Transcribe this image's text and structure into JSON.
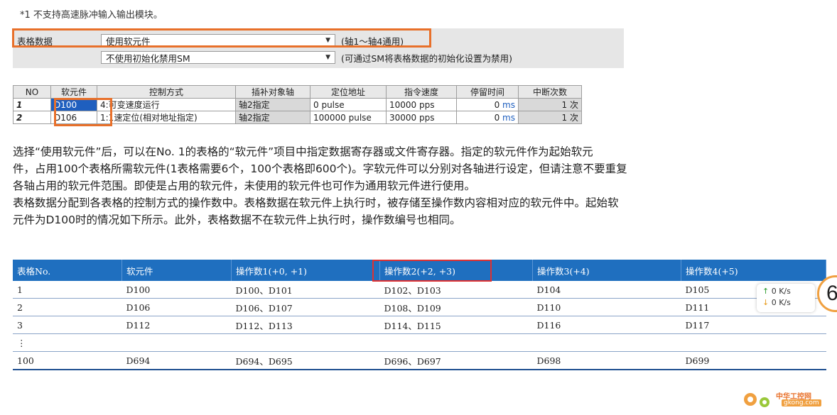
{
  "note": "*1  不支持高速脉冲输入输出模块。",
  "settings": {
    "label": "表格数据",
    "dropdown1": "使用软元件",
    "note1": "(轴1～轴4通用)",
    "dropdown2": "不使用初始化禁用SM",
    "note2": "(可通过SM将表格数据的初始化设置为禁用)"
  },
  "grid": {
    "headers": [
      "NO",
      "软元件",
      "控制方式",
      "插补对象轴",
      "定位地址",
      "指令速度",
      "停留时间",
      "中断次数"
    ],
    "rows": [
      {
        "no": "1",
        "device": "D100",
        "method": "4:可变速度运行",
        "axis": "轴2指定",
        "addr": "0 pulse",
        "speed": "10000 pps",
        "dwell": "0",
        "dwell_unit": "ms",
        "count": "1 次"
      },
      {
        "no": "2",
        "device": "D106",
        "method": "1:1速定位(相对地址指定)",
        "axis": "轴2指定",
        "addr": "100000 pulse",
        "speed": "30000 pps",
        "dwell": "0",
        "dwell_unit": "ms",
        "count": "1 次"
      }
    ]
  },
  "paragraph": {
    "line1": "选择“使用软元件”后，可以在No. 1的表格的“软元件”项目中指定数据寄存器或文件寄存器。指定的软元件作为起始软元",
    "line2": "件，占用100个表格所需软元件(1表格需要6个，100个表格即600个)。字软元件可以分别对各轴进行设定，但请注意不要重复",
    "line3": "各轴占用的软元件范围。即使是占用的软元件，未使用的软元件也可作为通用软元件进行使用。",
    "line4": "表格数据分配到各表格的控制方式的操作数中。表格数据在软元件上执行时，被存储至操作数内容相对应的软元件中。起始软",
    "line5": "元件为D100时的情况如下所示。此外，表格数据不在软元件上执行时，操作数编号也相同。"
  },
  "table": {
    "headers": [
      "表格No.",
      "软元件",
      "操作数1(+0, +1)",
      "操作数2(+2, +3)",
      "操作数3(+4)",
      "操作数4(+5)"
    ],
    "rows": [
      [
        "1",
        "D100",
        "D100、D101",
        "D102、D103",
        "D104",
        "D105"
      ],
      [
        "2",
        "D106",
        "D106、D107",
        "D108、D109",
        "D110",
        "D111"
      ],
      [
        "3",
        "D112",
        "D112、D113",
        "D114、D115",
        "D116",
        "D117"
      ],
      [
        "⋮",
        "",
        "",
        "",
        "",
        ""
      ],
      [
        "100",
        "D694",
        "D694、D695",
        "D696、D697",
        "D698",
        "D699"
      ]
    ]
  },
  "speed_widget": {
    "up": "0",
    "down": "0",
    "unit": "K/s"
  },
  "badge": "6",
  "watermark": {
    "text": "中华工控网",
    "sub": "gkong.com"
  },
  "colors": {
    "orange": "#e8702a",
    "red": "#e03030",
    "header_blue": "#1f6fbf",
    "select_blue": "#1f5fbf"
  }
}
